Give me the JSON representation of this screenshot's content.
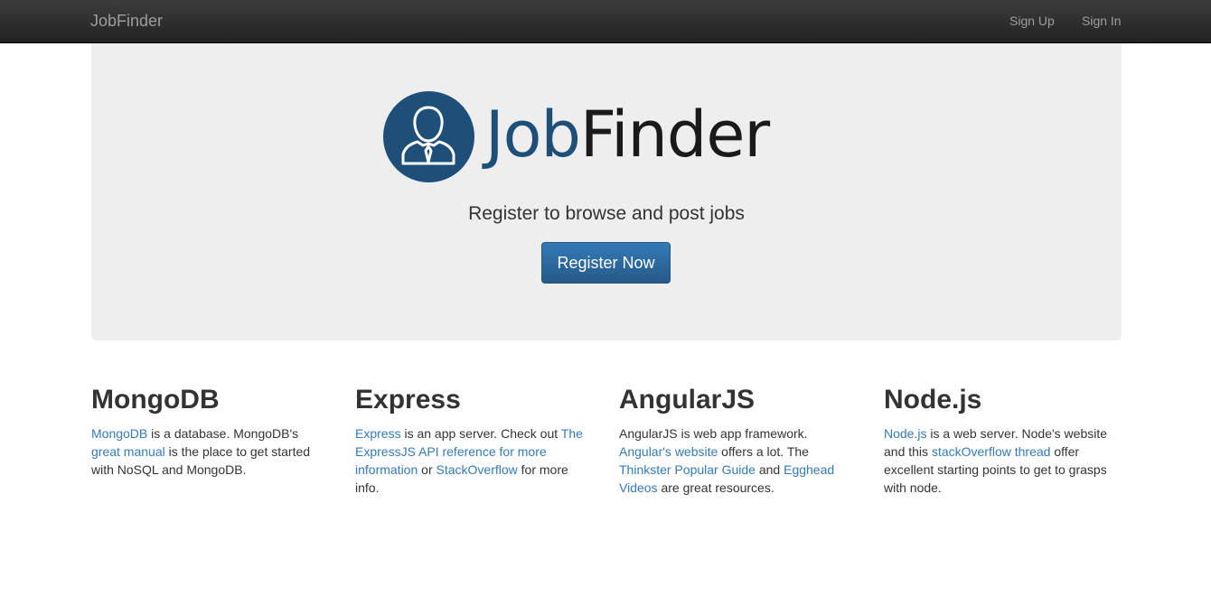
{
  "navbar": {
    "brand": "JobFinder",
    "links": [
      {
        "label": "Sign Up"
      },
      {
        "label": "Sign In"
      }
    ]
  },
  "hero": {
    "logo_text_part1": "Job",
    "logo_text_part2": "Finder",
    "tagline": "Register to browse and post jobs",
    "button_label": "Register Now"
  },
  "colors": {
    "navbar_bg": "#222222",
    "brand_blue": "#1e4f78",
    "link_blue": "#337ab7",
    "jumbotron_bg": "#eeeeee"
  },
  "icons": {
    "logo": "person-with-tie-icon"
  },
  "columns": [
    {
      "title": "MongoDB",
      "parts": [
        {
          "text": "MongoDB",
          "link": true
        },
        {
          "text": " is a database. MongoDB's ",
          "link": false
        },
        {
          "text": "great manual",
          "link": true
        },
        {
          "text": " is the place to get started with NoSQL and MongoDB.",
          "link": false
        }
      ]
    },
    {
      "title": "Express",
      "parts": [
        {
          "text": "Express",
          "link": true
        },
        {
          "text": " is an app server. Check out ",
          "link": false
        },
        {
          "text": "The ExpressJS API reference for more information",
          "link": true
        },
        {
          "text": " or ",
          "link": false
        },
        {
          "text": "StackOverflow",
          "link": true
        },
        {
          "text": " for more info.",
          "link": false
        }
      ]
    },
    {
      "title": "AngularJS",
      "parts": [
        {
          "text": "AngularJS is web app framework. ",
          "link": false
        },
        {
          "text": "Angular's website",
          "link": true
        },
        {
          "text": " offers a lot. The ",
          "link": false
        },
        {
          "text": "Thinkster Popular Guide",
          "link": true
        },
        {
          "text": " and ",
          "link": false
        },
        {
          "text": "Egghead Videos",
          "link": true
        },
        {
          "text": " are great resources.",
          "link": false
        }
      ]
    },
    {
      "title": "Node.js",
      "parts": [
        {
          "text": "Node.js",
          "link": true
        },
        {
          "text": " is a web server. Node's website and this ",
          "link": false
        },
        {
          "text": "stackOverflow thread",
          "link": true
        },
        {
          "text": " offer excellent starting points to get to grasps with node.",
          "link": false
        }
      ]
    }
  ]
}
